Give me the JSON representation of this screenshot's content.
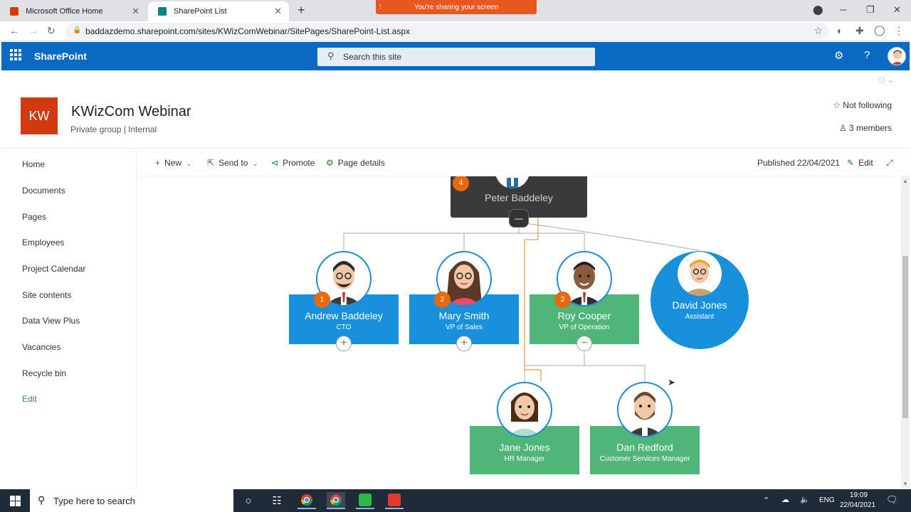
{
  "browser": {
    "tabs": [
      {
        "label": "Microsoft Office Home",
        "favicon_color": "#d83b01"
      },
      {
        "label": "SharePoint List",
        "favicon_color": "#038387"
      }
    ],
    "sharing_banner": "You're sharing your screen",
    "url": "baddazdemo.sharepoint.com/sites/KWizComWebinar/SitePages/SharePoint-List.aspx"
  },
  "suite": {
    "app_name": "SharePoint",
    "search_placeholder": "Search this site",
    "accent": "#0969c3"
  },
  "site": {
    "logo_text": "KW",
    "logo_color": "#d13910",
    "title": "KWizCom Webinar",
    "subtitle": "Private group | Internal",
    "follow_label": "Not following",
    "members_label": "3 members"
  },
  "nav": {
    "items": [
      "Home",
      "Documents",
      "Pages",
      "Employees",
      "Project Calendar",
      "Site contents",
      "Data View Plus",
      "Vacancies",
      "Recycle bin"
    ],
    "edit_label": "Edit"
  },
  "commands": {
    "new": "New",
    "send_to": "Send to",
    "promote": "Promote",
    "page_details": "Page details",
    "published": "Published 22/04/2021",
    "edit": "Edit"
  },
  "org": {
    "root": {
      "name": "Peter Baddeley",
      "badge": "4"
    },
    "level1": [
      {
        "name": "Andrew Baddeley",
        "title": "CTO",
        "badge": "1",
        "color": "#1890dc"
      },
      {
        "name": "Mary Smith",
        "title": "VP of Sales",
        "badge": "2",
        "color": "#1890dc"
      },
      {
        "name": "Roy Cooper",
        "title": "VP of Operation",
        "badge": "2",
        "color": "#4fb578"
      }
    ],
    "assistant": {
      "name": "David Jones",
      "title": "Assistant",
      "color": "#1890dc"
    },
    "level2": [
      {
        "name": "Jane Jones",
        "title": "HR Manager",
        "color": "#4fb578"
      },
      {
        "name": "Dan Redford",
        "title": "Customer Services Manager",
        "color": "#4fb578"
      }
    ]
  },
  "taskbar": {
    "search_placeholder": "Type here to search",
    "language": "ENG",
    "time": "19:09",
    "date": "22/04/2021"
  }
}
